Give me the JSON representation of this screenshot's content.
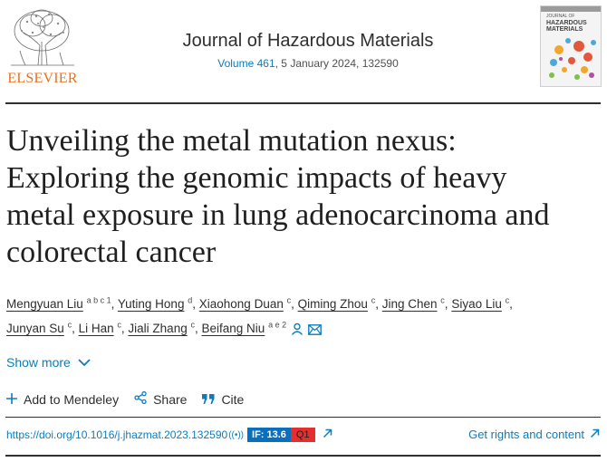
{
  "header": {
    "publisher": "ELSEVIER",
    "journal_title": "Journal of Hazardous Materials",
    "volume": "Volume 461",
    "issue_info": ", 5 January 2024, 132590",
    "cover_text_top": "JOURNAL OF",
    "cover_text_main": "HAZARDOUS MATERIALS"
  },
  "article": {
    "title_lines": [
      "Unveiling the metal mutation nexus:",
      "Exploring the genomic impacts of heavy",
      "metal exposure in lung adenocarcinoma and",
      "colorectal cancer"
    ]
  },
  "authors": [
    {
      "name": "Mengyuan Liu",
      "aff": "a b c 1"
    },
    {
      "name": "Yuting Hong",
      "aff": "d"
    },
    {
      "name": "Xiaohong Duan",
      "aff": "c"
    },
    {
      "name": "Qiming Zhou",
      "aff": "c"
    },
    {
      "name": "Jing Chen",
      "aff": "c"
    },
    {
      "name": "Siyao Liu",
      "aff": "c"
    },
    {
      "name": "Junyan Su",
      "aff": "c"
    },
    {
      "name": "Li Han",
      "aff": "c"
    },
    {
      "name": "Jiali Zhang",
      "aff": "c"
    },
    {
      "name": "Beifang Niu",
      "aff": "a e 2"
    }
  ],
  "links": {
    "show_more": "Show more",
    "add_to_mendeley": "Add to Mendeley",
    "share": "Share",
    "cite": "Cite",
    "doi": "https://doi.org/10.1016/j.jhazmat.2023.132590",
    "impact_factor": "IF: 13.6",
    "quartile": "Q1",
    "rights": "Get rights and content"
  },
  "colors": {
    "link": "#0c7dbb",
    "elsevier_orange": "#e9711c",
    "if_badge": "#0a6fbd",
    "q_badge": "#e62e2e"
  }
}
